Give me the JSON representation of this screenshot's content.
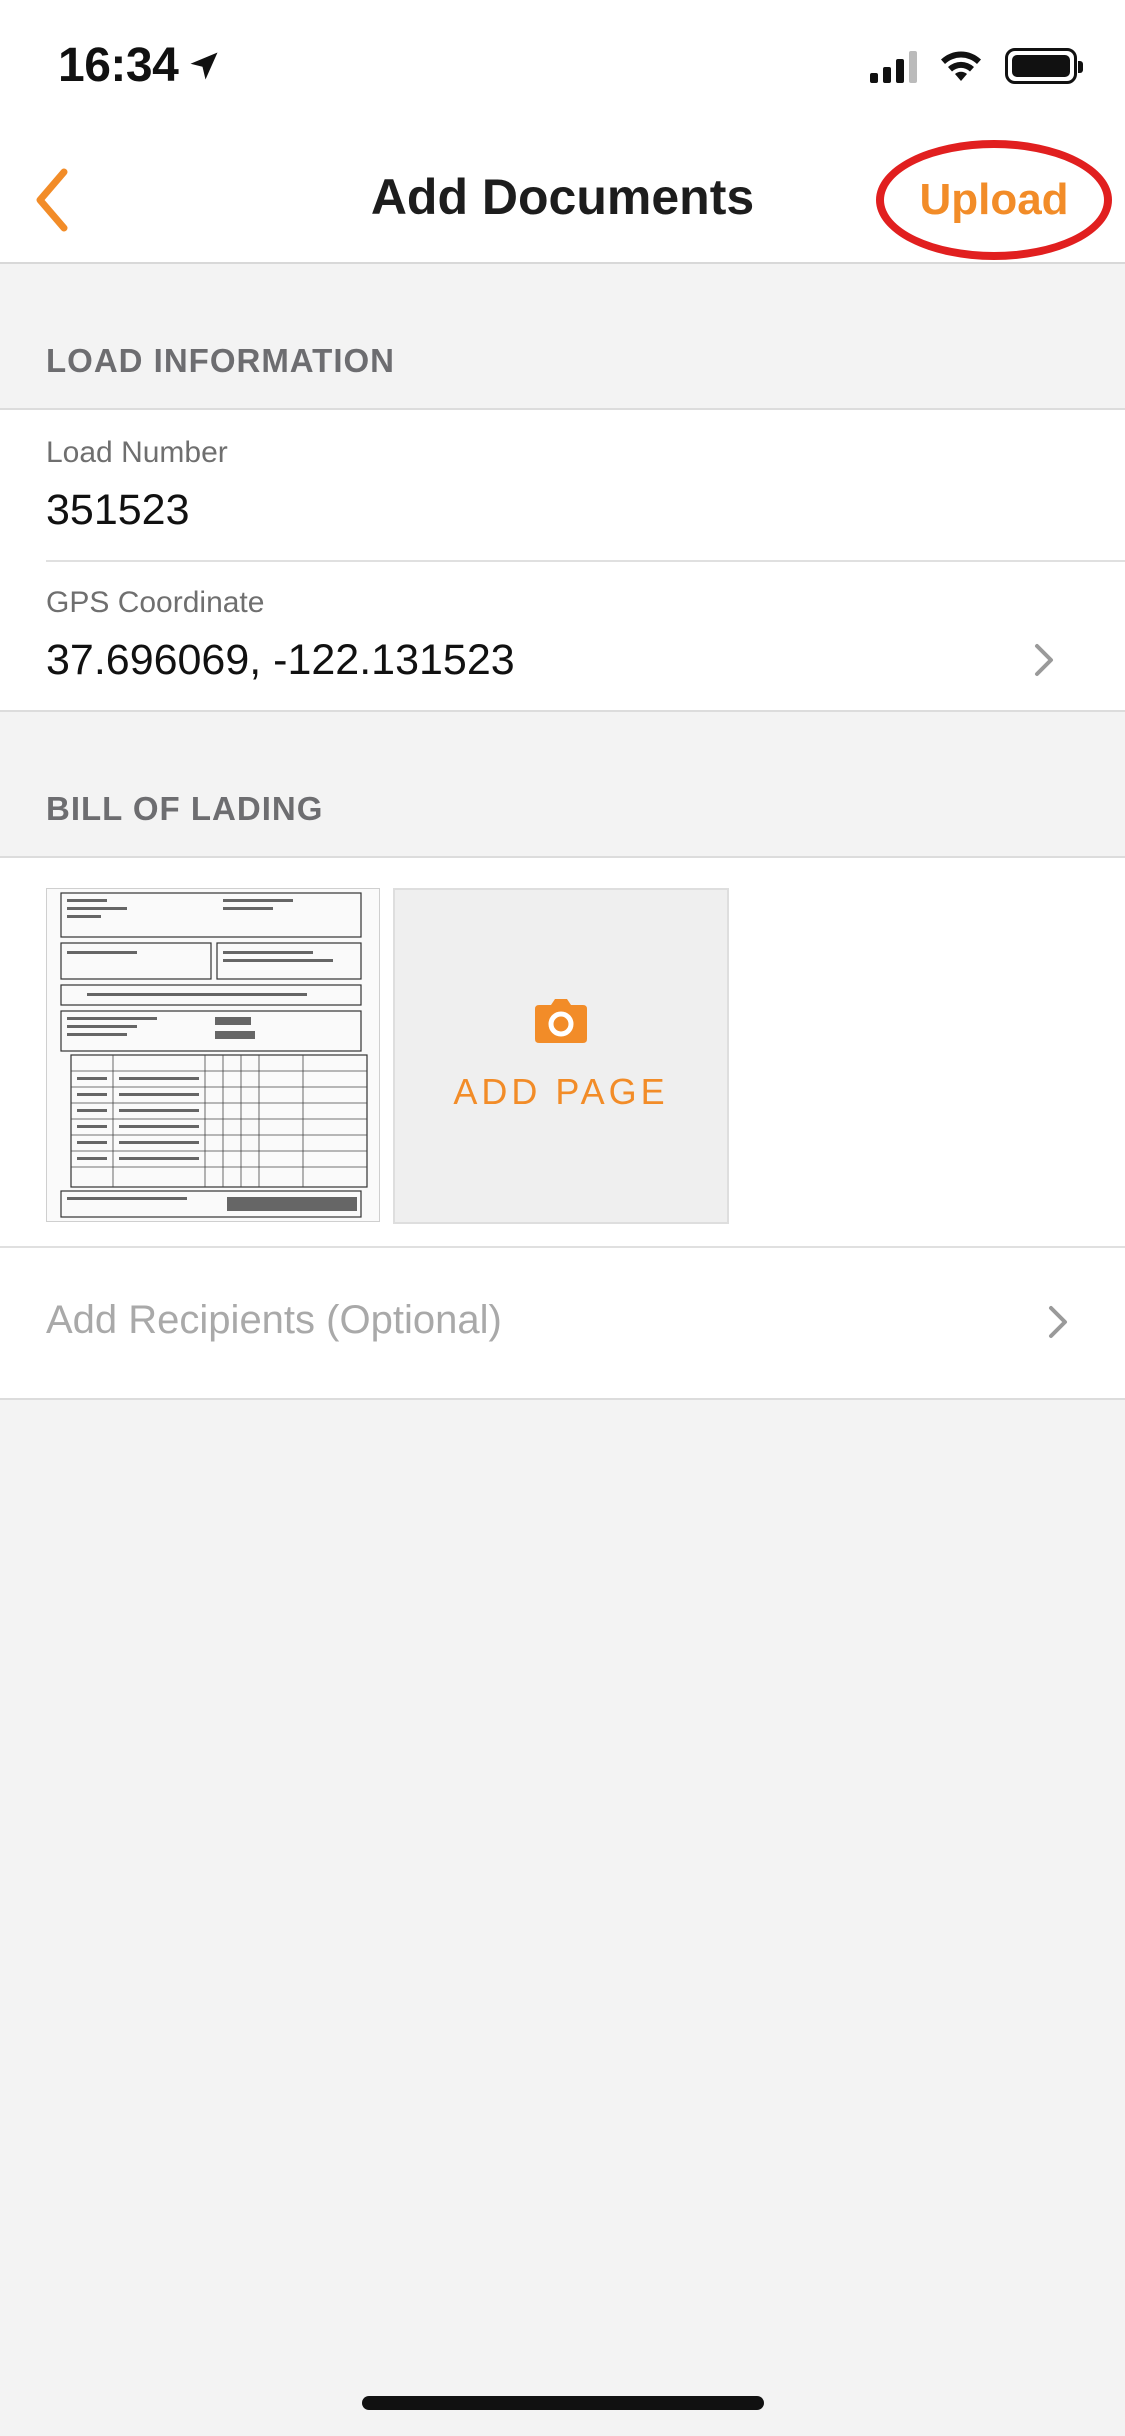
{
  "status_bar": {
    "time": "16:34",
    "icons": [
      "location-arrow-icon",
      "cellular-signal-icon",
      "wifi-icon",
      "battery-icon"
    ]
  },
  "nav": {
    "back_icon": "chevron-left-icon",
    "title": "Add Documents",
    "upload_label": "Upload",
    "accent_color": "#F28C28",
    "highlight_color": "#E11F1F"
  },
  "load_info": {
    "section_title": "LOAD INFORMATION",
    "load_number_label": "Load Number",
    "load_number_value": "351523",
    "gps_label": "GPS Coordinate",
    "gps_value": "37.696069, -122.131523"
  },
  "bill_of_lading": {
    "section_title": "BILL OF LADING",
    "add_page_label": "ADD PAGE",
    "camera_icon": "camera-icon"
  },
  "recipients": {
    "label": "Add Recipients (Optional)"
  }
}
